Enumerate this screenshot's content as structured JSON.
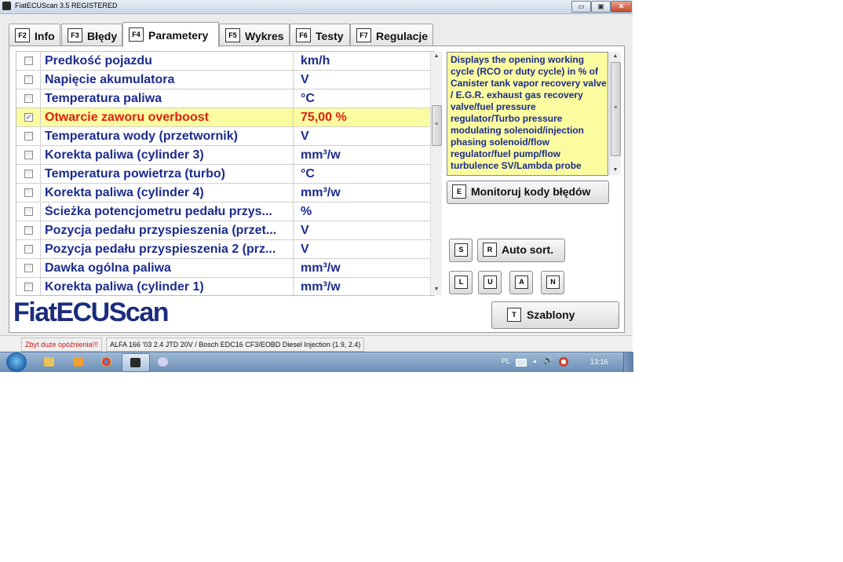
{
  "window": {
    "title": "FiatECUScan 3.5 REGISTERED",
    "minimize_glyph": "▭",
    "maximize_glyph": "▣",
    "close_glyph": "✕"
  },
  "tabs": [
    {
      "key": "F2",
      "label": "Info",
      "active": false
    },
    {
      "key": "F3",
      "label": "Błędy",
      "active": false
    },
    {
      "key": "F4",
      "label": "Parametery",
      "active": true
    },
    {
      "key": "F5",
      "label": "Wykres",
      "active": false
    },
    {
      "key": "F6",
      "label": "Testy",
      "active": false
    },
    {
      "key": "F7",
      "label": "Regulacje",
      "active": false
    }
  ],
  "parameters": [
    {
      "name": "Predkość pojazdu",
      "unit": "km/h",
      "checked": false
    },
    {
      "name": "Napięcie akumulatora",
      "unit": "V",
      "checked": false
    },
    {
      "name": "Temperatura paliwa",
      "unit": "°C",
      "checked": false
    },
    {
      "name": "Otwarcie zaworu overboost",
      "unit": "75,00 %",
      "checked": true,
      "selected": true
    },
    {
      "name": "Temperatura wody (przetwornik)",
      "unit": "V",
      "checked": false
    },
    {
      "name": "Korekta paliwa (cylinder 3)",
      "unit": "mm³/w",
      "checked": false
    },
    {
      "name": "Temperatura powietrza (turbo)",
      "unit": "°C",
      "checked": false
    },
    {
      "name": "Korekta paliwa (cylinder 4)",
      "unit": "mm³/w",
      "checked": false
    },
    {
      "name": "Ścieżka potencjometru pedału przys...",
      "unit": "%",
      "checked": false
    },
    {
      "name": "Pozycja pedału przyspieszenia (przet...",
      "unit": "V",
      "checked": false
    },
    {
      "name": "Pozycja pedału przyspieszenia 2 (prz...",
      "unit": "V",
      "checked": false
    },
    {
      "name": "Dawka ogólna paliwa",
      "unit": "mm³/w",
      "checked": false
    },
    {
      "name": "Korekta paliwa (cylinder 1)",
      "unit": "mm³/w",
      "checked": false
    }
  ],
  "description": "Displays the opening working cycle (RCO or duty cycle) in % of Canister tank vapor recovery valve / E.G.R. exhaust gas recovery valve/fuel pressure regulator/Turbo pressure modulating solenoid/injection phasing solenoid/flow regulator/fuel pump/flow turbulence SV/Lambda probe",
  "buttons": {
    "monitor": {
      "key": "E",
      "label": "Monitoruj kody błędów"
    },
    "s_key": "S",
    "autosort": {
      "key": "R",
      "label": "Auto sort."
    },
    "l_key": "L",
    "u_key": "U",
    "a_key": "A",
    "n_key": "N",
    "templates": {
      "key": "T",
      "label": "Szablony"
    }
  },
  "logo": "FiatECUScan",
  "status": {
    "warning": "Zbyt duże opóźnienia!!!",
    "vehicle": "ALFA 166 '03 2.4 JTD 20V / Bosch EDC16 CF3/EOBD Diesel Injection (1.9, 2.4)"
  },
  "taskbar": {
    "lang": "PL",
    "time": "13:16",
    "tray_arrow": "▲",
    "volume_glyph": "🔊"
  },
  "glyphs": {
    "check": "✓",
    "up": "▲",
    "down": "▼",
    "grip": "≡"
  },
  "colors": {
    "accent_text": "#1c2c8c",
    "selected_text": "#e02010",
    "highlight": "#fbfba0",
    "warning": "#d01010"
  }
}
